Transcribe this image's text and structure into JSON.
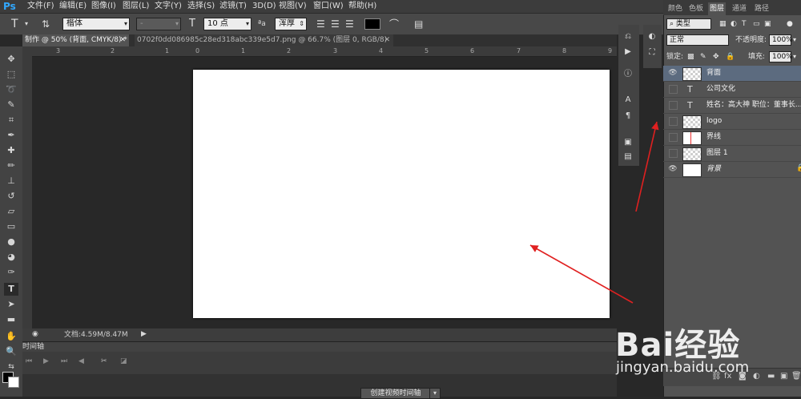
{
  "app": {
    "logo": "Ps"
  },
  "menu": [
    "文件(F)",
    "编辑(E)",
    "图像(I)",
    "图层(L)",
    "文字(Y)",
    "选择(S)",
    "滤镜(T)",
    "3D(D)",
    "视图(V)",
    "窗口(W)",
    "帮助(H)"
  ],
  "options": {
    "font_family": "楷体",
    "font_style": "-",
    "font_size": "10 点",
    "aa_label": "ªa",
    "antialias": "浑厚"
  },
  "tabs": [
    {
      "label": "制作 @ 50% (背面, CMYK/8) *"
    },
    {
      "label": "0702f0dd086985c28ed318abc339e5d7.png @ 66.7% (图层 0, RGB/8)"
    }
  ],
  "ruler": [
    "3",
    "2",
    "1",
    "0",
    "1",
    "2",
    "3",
    "4",
    "5",
    "6",
    "7",
    "8",
    "9"
  ],
  "status": {
    "doc": "文档:4.59M/8.47M"
  },
  "timeline": {
    "label": "时间轴",
    "create_button": "创建视频时间轴"
  },
  "layers_panel": {
    "tabs": [
      "颜色",
      "色板",
      "图层",
      "通道",
      "路径"
    ],
    "active_tab": "图层",
    "filter": "类型",
    "blend_mode": "正常",
    "opacity_label": "不透明度:",
    "opacity": "100%",
    "lock_label": "锁定:",
    "fill_label": "填充:",
    "fill": "100%",
    "layers": [
      {
        "name": "背面",
        "kind": "pixel",
        "visible": true,
        "selected": true
      },
      {
        "name": "公司文化",
        "kind": "text",
        "visible": false,
        "selected": false
      },
      {
        "name": "姓名：高大神 职位：董事长...",
        "kind": "text",
        "visible": false,
        "selected": false
      },
      {
        "name": "logo",
        "kind": "pixel",
        "visible": false,
        "selected": false
      },
      {
        "name": "界线",
        "kind": "lines",
        "visible": false,
        "selected": false
      },
      {
        "name": "图层 1",
        "kind": "pixel",
        "visible": false,
        "selected": false
      },
      {
        "name": "背景",
        "kind": "background",
        "visible": true,
        "selected": false
      }
    ]
  },
  "watermark": {
    "logo": "Bai经验",
    "url": "jingyan.baidu.com"
  },
  "colors": {
    "accent_arrow": "#e02020",
    "ps_blue": "#31a8ff",
    "selected_layer": "#5c6b7f"
  }
}
